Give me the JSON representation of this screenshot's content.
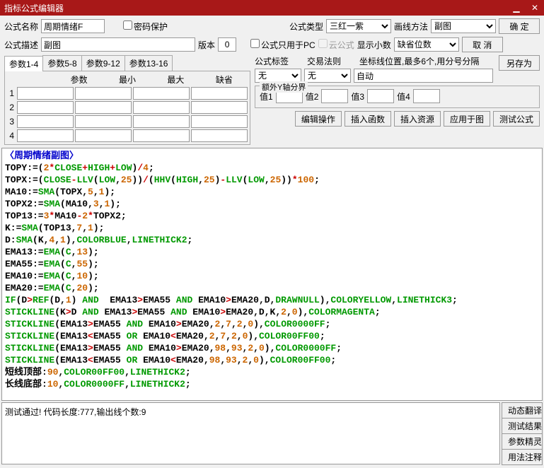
{
  "title": "指标公式编辑器",
  "labels": {
    "formula_name": "公式名称",
    "password_protect": "密码保护",
    "formula_type": "公式类型",
    "draw_method": "画线方法",
    "formula_desc": "公式描述",
    "version": "版本",
    "pc_only": "公式只用于PC",
    "cloud_formula": "云公式",
    "show_decimal": "显示小数",
    "formula_tag": "公式标签",
    "trade_rule": "交易法则",
    "coord_pos": "坐标线位置,最多6个,用分号分隔",
    "extra_y": "额外Y轴分界",
    "val1": "值1",
    "val2": "值2",
    "val3": "值3",
    "val4": "值4",
    "param_name": "参数",
    "param_min": "最小",
    "param_max": "最大",
    "param_def": "缺省"
  },
  "values": {
    "formula_name": "周期情绪F",
    "formula_type": "三红一紫",
    "draw_method": "副图",
    "formula_desc": "副图",
    "version": "0",
    "show_decimal": "缺省位数",
    "formula_tag": "无",
    "trade_rule": "无",
    "coord_pos": "自动"
  },
  "buttons": {
    "ok": "确 定",
    "cancel": "取 消",
    "save_as": "另存为",
    "edit_op": "编辑操作",
    "insert_func": "插入函数",
    "insert_res": "插入资源",
    "apply_chart": "应用于图",
    "test_formula": "测试公式",
    "dyn_translate": "动态翻译",
    "test_result": "测试结果",
    "param_wizard": "参数精灵",
    "usage_notes": "用法注释"
  },
  "tabs": {
    "t1": "参数1-4",
    "t2": "参数5-8",
    "t3": "参数9-12",
    "t4": "参数13-16"
  },
  "code_title": "〈周期情绪副图〉",
  "result": "测试通过! 代码长度:777,输出线个数:9"
}
